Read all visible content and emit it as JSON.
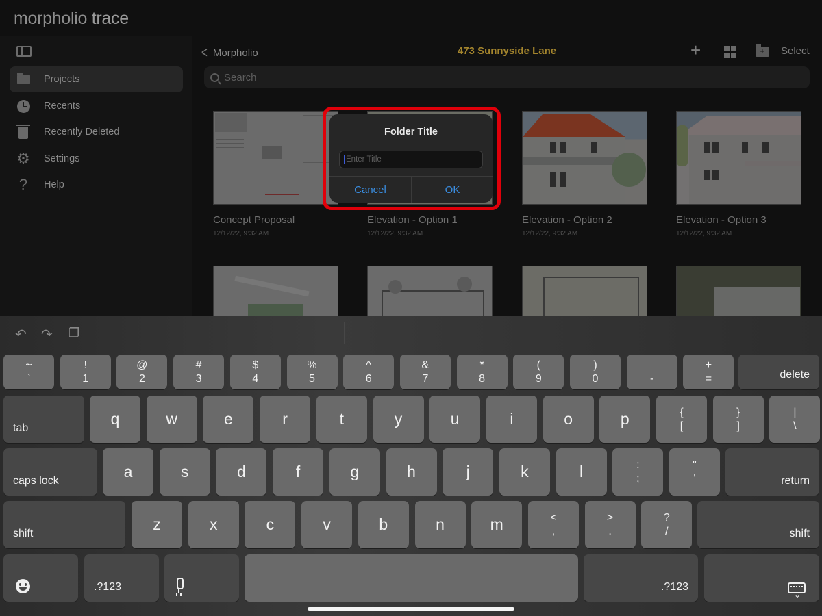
{
  "app": {
    "title_light": "morpholio",
    "title_bold": "trace"
  },
  "sidebar": {
    "items": [
      {
        "label": "Projects",
        "icon": "folder-icon",
        "active": true
      },
      {
        "label": "Recents",
        "icon": "clock-icon"
      },
      {
        "label": "Recently Deleted",
        "icon": "trash-icon"
      },
      {
        "label": "Settings",
        "icon": "gear-icon"
      },
      {
        "label": "Help",
        "icon": "question-icon"
      }
    ]
  },
  "header": {
    "back_label": "Morpholio",
    "title": "473 Sunnyside Lane",
    "title_color": "#a4852d",
    "select_label": "Select"
  },
  "search": {
    "placeholder": "Search"
  },
  "projects": [
    {
      "title": "Concept Proposal",
      "date": "12/12/22, 9:32 AM"
    },
    {
      "title": "Elevation - Option 1",
      "date": "12/12/22, 9:32 AM"
    },
    {
      "title": "Elevation - Option 2",
      "date": "12/12/22, 9:32 AM"
    },
    {
      "title": "Elevation - Option 3",
      "date": "12/12/22, 9:32 AM"
    }
  ],
  "dialog": {
    "title": "Folder Title",
    "input_value": "",
    "input_placeholder": "Enter Title",
    "cancel_label": "Cancel",
    "ok_label": "OK",
    "highlight_color": "#e0000a",
    "button_color": "#3a8de0"
  },
  "keyboard": {
    "row1": [
      {
        "top": "~",
        "bottom": "`"
      },
      {
        "top": "!",
        "bottom": "1"
      },
      {
        "top": "@",
        "bottom": "2"
      },
      {
        "top": "#",
        "bottom": "3"
      },
      {
        "top": "$",
        "bottom": "4"
      },
      {
        "top": "%",
        "bottom": "5"
      },
      {
        "top": "^",
        "bottom": "6"
      },
      {
        "top": "&",
        "bottom": "7"
      },
      {
        "top": "*",
        "bottom": "8"
      },
      {
        "top": "(",
        "bottom": "9"
      },
      {
        "top": ")",
        "bottom": "0"
      },
      {
        "top": "_",
        "bottom": "-"
      },
      {
        "top": "+",
        "bottom": "="
      }
    ],
    "delete_label": "delete",
    "tab_label": "tab",
    "row2": [
      "q",
      "w",
      "e",
      "r",
      "t",
      "y",
      "u",
      "i",
      "o",
      "p"
    ],
    "row2_extra": [
      {
        "top": "{",
        "bottom": "["
      },
      {
        "top": "}",
        "bottom": "]"
      },
      {
        "top": "|",
        "bottom": "\\"
      }
    ],
    "caps_label": "caps lock",
    "row3": [
      "a",
      "s",
      "d",
      "f",
      "g",
      "h",
      "j",
      "k",
      "l"
    ],
    "row3_extra": [
      {
        "top": ":",
        "bottom": ";"
      },
      {
        "top": "\"",
        "bottom": "'"
      }
    ],
    "return_label": "return",
    "shift_label": "shift",
    "row4": [
      "z",
      "x",
      "c",
      "v",
      "b",
      "n",
      "m"
    ],
    "row4_extra": [
      {
        "top": "<",
        "bottom": ","
      },
      {
        "top": ">",
        "bottom": "."
      },
      {
        "top": "?",
        "bottom": "/"
      }
    ],
    "numbers_label": ".?123"
  }
}
